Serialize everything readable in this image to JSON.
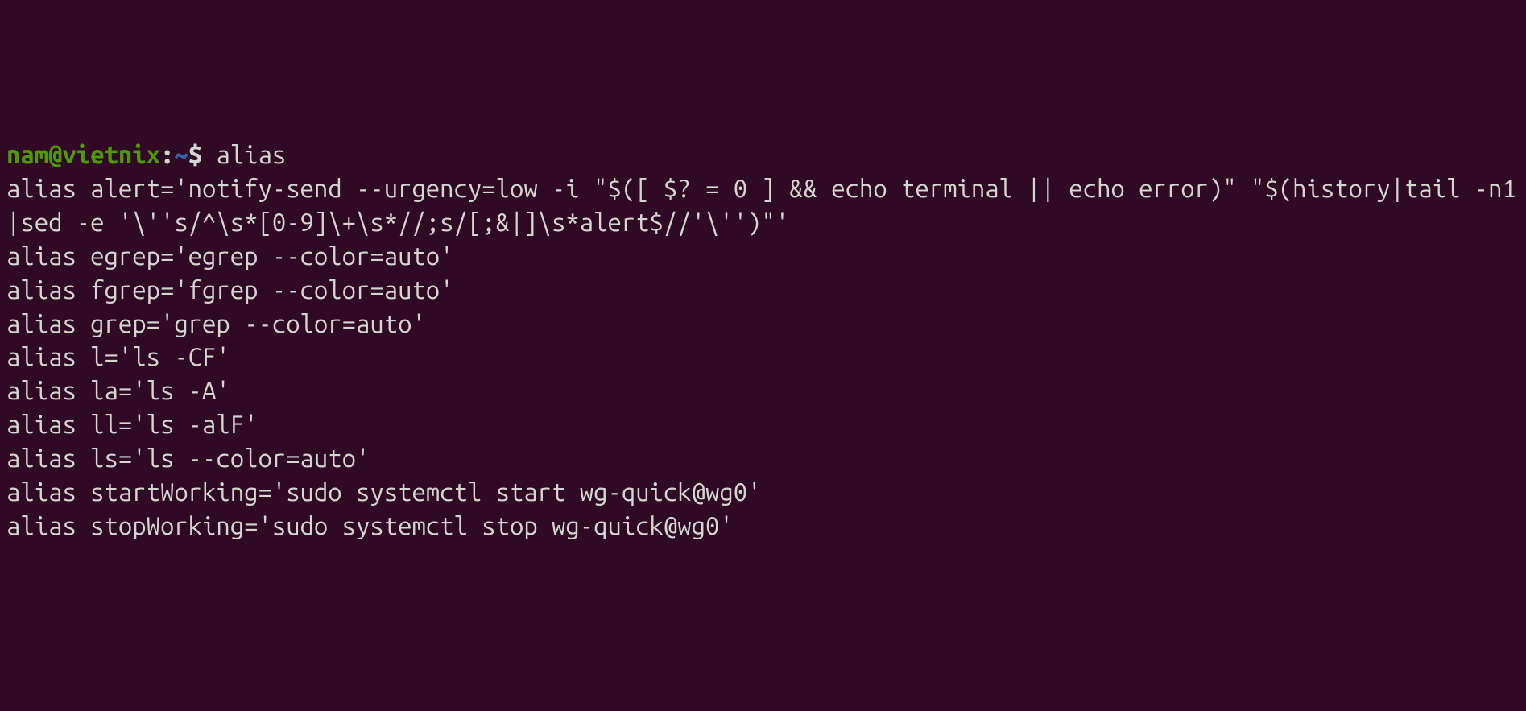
{
  "prompt": {
    "user": "nam",
    "at": "@",
    "host": "vietnix",
    "colon": ":",
    "path": "~",
    "dollar": "$ "
  },
  "command": "alias",
  "output_lines": [
    "alias alert='notify-send --urgency=low -i \"$([ $? = 0 ] && echo terminal || echo error)\" \"$(history|tail -n1|sed -e '\\''s/^\\s*[0-9]\\+\\s*//;s/[;&|]\\s*alert$//'\\'')\"'",
    "alias egrep='egrep --color=auto'",
    "alias fgrep='fgrep --color=auto'",
    "alias grep='grep --color=auto'",
    "alias l='ls -CF'",
    "alias la='ls -A'",
    "alias ll='ls -alF'",
    "alias ls='ls --color=auto'",
    "alias startWorking='sudo systemctl start wg-quick@wg0'",
    "alias stopWorking='sudo systemctl stop wg-quick@wg0'"
  ]
}
